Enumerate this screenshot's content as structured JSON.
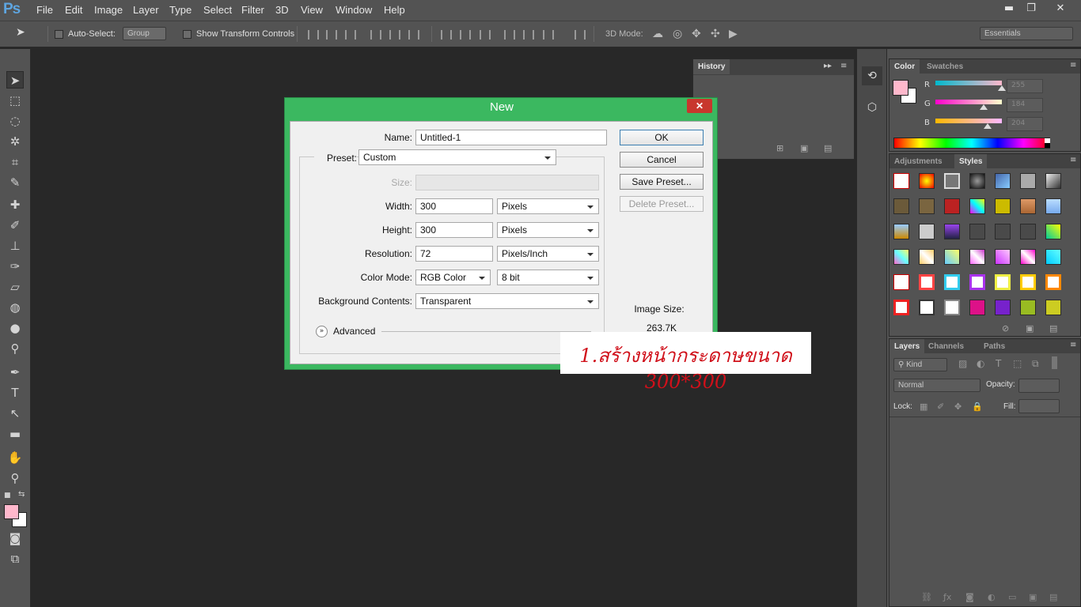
{
  "app": {
    "logo": "Ps"
  },
  "menu": [
    "File",
    "Edit",
    "Image",
    "Layer",
    "Type",
    "Select",
    "Filter",
    "3D",
    "View",
    "Window",
    "Help"
  ],
  "window_controls": {
    "minimize": "▬",
    "restore": "❐",
    "close": "✕"
  },
  "options": {
    "auto_select_label": "Auto-Select:",
    "auto_select_target": "Group",
    "show_transform_label": "Show Transform Controls",
    "mode_3d_label": "3D Mode:",
    "workspace": "Essentials"
  },
  "history_panel": {
    "tab": "History"
  },
  "color_panel": {
    "tabs": [
      "Color",
      "Swatches"
    ],
    "channels": [
      {
        "name": "R",
        "value": "255"
      },
      {
        "name": "G",
        "value": "184"
      },
      {
        "name": "B",
        "value": "204"
      }
    ],
    "foreground_color": "#ffb8cc"
  },
  "styles_panel": {
    "tabs": [
      "Adjustments",
      "Styles"
    ]
  },
  "layers_panel": {
    "tabs": [
      "Layers",
      "Channels",
      "Paths"
    ],
    "filter_kind": "Kind",
    "blend_mode": "Normal",
    "opacity_label": "Opacity:",
    "lock_label": "Lock:",
    "fill_label": "Fill:"
  },
  "dialog": {
    "title": "New",
    "close": "✕",
    "name_label": "Name:",
    "name_value": "Untitled-1",
    "preset_label": "Preset:",
    "preset_value": "Custom",
    "size_label": "Size:",
    "width_label": "Width:",
    "width_value": "300",
    "width_unit": "Pixels",
    "height_label": "Height:",
    "height_value": "300",
    "height_unit": "Pixels",
    "resolution_label": "Resolution:",
    "resolution_value": "72",
    "resolution_unit": "Pixels/Inch",
    "color_mode_label": "Color Mode:",
    "color_mode_value": "RGB Color",
    "bit_depth": "8 bit",
    "bg_label": "Background Contents:",
    "bg_value": "Transparent",
    "advanced_label": "Advanced",
    "ok": "OK",
    "cancel": "Cancel",
    "save_preset": "Save Preset...",
    "delete_preset": "Delete Preset...",
    "image_size_label": "Image Size:",
    "image_size_value": "263.7K"
  },
  "annotation": "1.สร้างหน้ากระดาษขนาด 300*300"
}
